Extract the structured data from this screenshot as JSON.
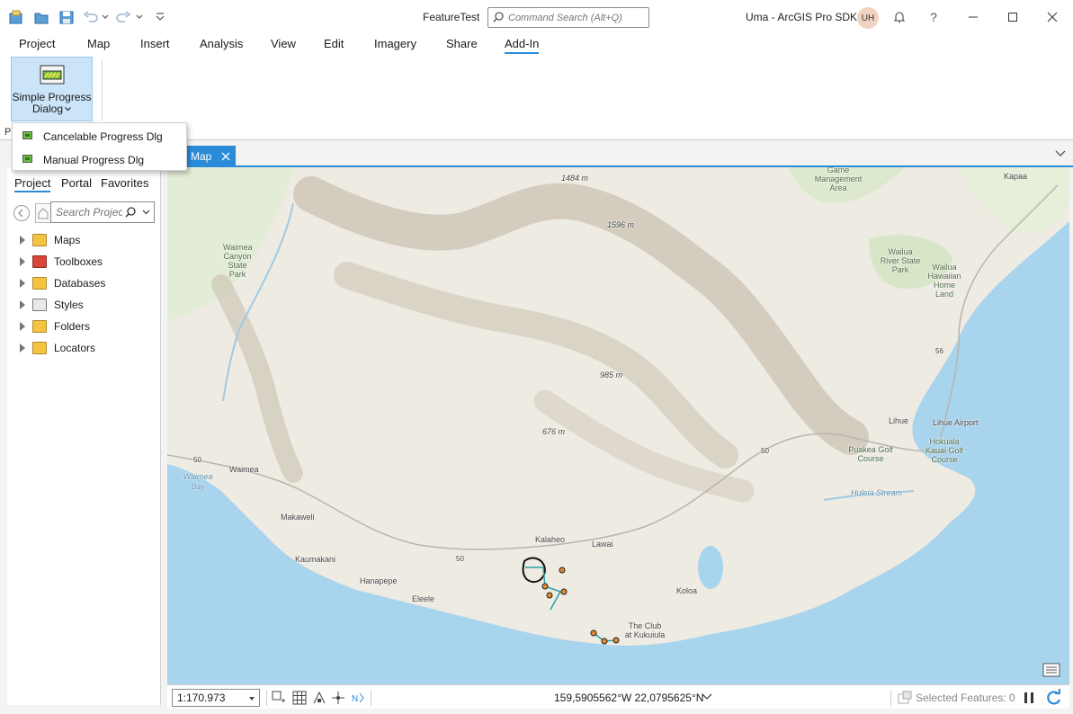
{
  "titlebar": {
    "document_title": "FeatureTest",
    "command_search_placeholder": "Command Search (Alt+Q)",
    "app_title": "Uma - ArcGIS Pro SDK",
    "avatar_initials": "UH",
    "help_symbol": "?"
  },
  "ribbon": {
    "tabs": [
      "Project",
      "Map",
      "Insert",
      "Analysis",
      "View",
      "Edit",
      "Imagery",
      "Share",
      "Add-In"
    ],
    "active_tab": "Add-In",
    "button": {
      "label_line1": "Simple Progress",
      "label_line2": "Dialog"
    },
    "group_label_fragment": "P"
  },
  "dropdown": {
    "items": [
      "Cancelable Progress Dlg",
      "Manual Progress Dlg"
    ]
  },
  "catalog": {
    "tabs": [
      "Project",
      "Portal",
      "Favorites"
    ],
    "active_tab": "Project",
    "search_placeholder": "Search Project",
    "tree": [
      "Maps",
      "Toolboxes",
      "Databases",
      "Styles",
      "Folders",
      "Locators"
    ]
  },
  "map_view": {
    "tab_label": "Map",
    "labels": {
      "waimea_canyon": "Waimea Canyon State Park",
      "waimea_bay": "Waimea Bay",
      "waimea": "Waimea",
      "makaweli": "Makaweli",
      "kaumakani": "Kaumakani",
      "hanapepe": "Hanapepe",
      "eleele": "Eleele",
      "kalaheo": "Kalaheo",
      "lawai": "Lawai",
      "koloa": "Koloa",
      "club": "The Club at Kukuiula",
      "lihue": "Lihue",
      "lihue_airport": "Lihue Airport",
      "puakea": "Puakea Golf Course",
      "hokuala": "Hokuala Kauai Golf Course",
      "huleia": "Huleia Stream",
      "wailua_river": "Wailua River State Park",
      "wailua_home": "Wailua Hawaiian Home Land",
      "kapaa": "Kapaa",
      "game_mgmt": "Game Management Area",
      "elev_1484": "1484 m",
      "elev_1596": "1596 m",
      "elev_985": "985 m",
      "elev_676": "676 m",
      "hwy_50_a": "50",
      "hwy_50_b": "50",
      "hwy_50_c": "50",
      "hwy_56": "56"
    }
  },
  "status_bar": {
    "scale": "1:170.973",
    "coordinates": "159,5905562°W 22,0795625°N",
    "selected_features": "Selected Features: 0"
  },
  "colors": {
    "accent": "#2a8bd9",
    "ocean": "#a8d4ee",
    "land": "#eeebe2",
    "selection": "#cce4f7"
  },
  "icons": [
    "new-project-icon",
    "open-project-icon",
    "save-project-icon",
    "undo-icon",
    "redo-icon",
    "customize-icon",
    "search-icon",
    "bell-icon",
    "help-icon",
    "minimize-icon",
    "maximize-icon",
    "close-icon",
    "progress-dialog-icon",
    "back-icon",
    "home-icon",
    "map-icon",
    "toolbox-icon",
    "database-icon",
    "style-icon",
    "folder-icon",
    "locator-icon",
    "refresh-icon",
    "pause-icon"
  ]
}
